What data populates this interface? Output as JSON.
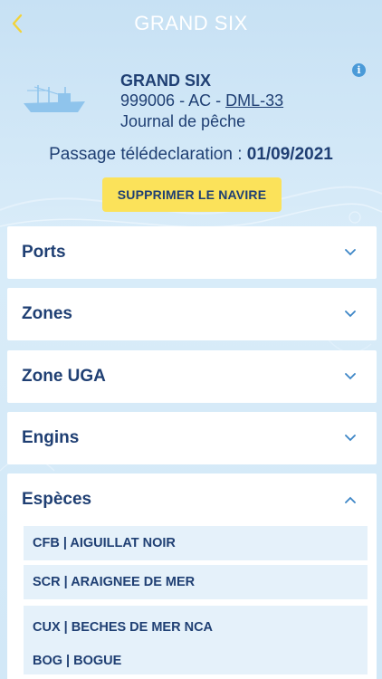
{
  "header": {
    "title": "GRAND SIX"
  },
  "vessel": {
    "name": "GRAND SIX",
    "id_prefix": "999006 - AC - ",
    "id_link": "DML-33",
    "journal": "Journal de pêche"
  },
  "passage": {
    "label": "Passage télédeclaration : ",
    "date": "01/09/2021"
  },
  "delete_button": {
    "label": "SUPPRIMER LE NAVIRE"
  },
  "sections": [
    {
      "label": "Ports",
      "expanded": false
    },
    {
      "label": "Zones",
      "expanded": false
    },
    {
      "label": "Zone UGA",
      "expanded": false
    },
    {
      "label": "Engins",
      "expanded": false
    },
    {
      "label": "Espèces",
      "expanded": true
    }
  ],
  "species": [
    "CFB | AIGUILLAT NOIR",
    "SCR | ARAIGNEE DE MER",
    "CUX | BECHES DE MER NCA",
    "BOG | BOGUE"
  ],
  "colors": {
    "background": "#cfe6f6",
    "text": "#1f3f73",
    "accent_yellow": "#fbe25a",
    "info_blue": "#4a9ad8",
    "chevron": "#3c86c6",
    "species_bg": "#e5f1fa"
  },
  "icons": {
    "back": "chevron-left-icon",
    "info": "info-icon",
    "vessel": "fishing-boat-icon",
    "collapsed": "chevron-down-icon",
    "expanded": "chevron-up-icon"
  }
}
